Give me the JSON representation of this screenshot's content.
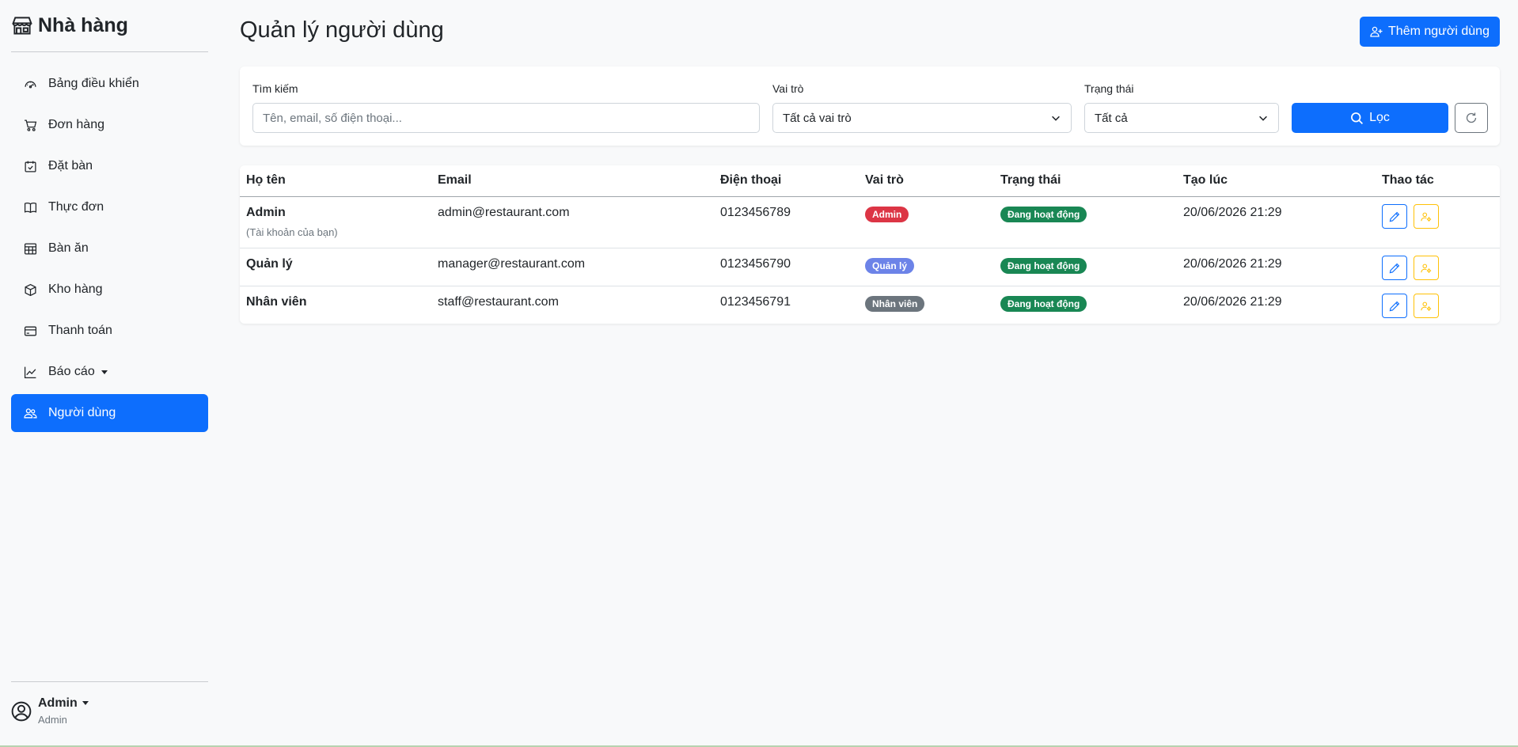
{
  "brand": {
    "name": "Nhà hàng"
  },
  "sidebar": {
    "items": [
      {
        "label": "Bảng điều khiển",
        "icon": "speedometer-icon"
      },
      {
        "label": "Đơn hàng",
        "icon": "cart-icon"
      },
      {
        "label": "Đặt bàn",
        "icon": "calendar-check-icon"
      },
      {
        "label": "Thực đơn",
        "icon": "book-icon"
      },
      {
        "label": "Bàn ăn",
        "icon": "table-icon"
      },
      {
        "label": "Kho hàng",
        "icon": "box-icon"
      },
      {
        "label": "Thanh toán",
        "icon": "credit-card-icon"
      },
      {
        "label": "Báo cáo",
        "icon": "graph-icon"
      },
      {
        "label": "Người dùng",
        "icon": "people-icon"
      }
    ],
    "active_index": 8
  },
  "user": {
    "name": "Admin",
    "role": "Admin"
  },
  "page": {
    "title": "Quản lý người dùng",
    "add_button": "Thêm người dùng"
  },
  "filters": {
    "search_label": "Tìm kiếm",
    "search_placeholder": "Tên, email, số điện thoại...",
    "role_label": "Vai trò",
    "role_value": "Tất cả vai trò",
    "status_label": "Trạng thái",
    "status_value": "Tất cả",
    "filter_button": "Lọc"
  },
  "table": {
    "headers": [
      "Họ tên",
      "Email",
      "Điện thoại",
      "Vai trò",
      "Trạng thái",
      "Tạo lúc",
      "Thao tác"
    ],
    "rows": [
      {
        "name": "Admin",
        "note": "(Tài khoản của bạn)",
        "email": "admin@restaurant.com",
        "phone": "0123456789",
        "role": "Admin",
        "role_color": "#dc3545",
        "status": "Đang hoạt động",
        "status_color": "#198754",
        "created": "20/06/2026 21:29"
      },
      {
        "name": "Quản lý",
        "email": "manager@restaurant.com",
        "phone": "0123456790",
        "role": "Quản lý",
        "role_color": "#6c83e8",
        "status": "Đang hoạt động",
        "status_color": "#198754",
        "created": "20/06/2026 21:29"
      },
      {
        "name": "Nhân viên",
        "email": "staff@restaurant.com",
        "phone": "0123456791",
        "role": "Nhân viên",
        "role_color": "#6c757d",
        "status": "Đang hoạt động",
        "status_color": "#198754",
        "created": "20/06/2026 21:29"
      }
    ]
  },
  "colors": {
    "primary": "#0d6efd",
    "warning": "#ffc107",
    "background": "#f8f9fa"
  }
}
